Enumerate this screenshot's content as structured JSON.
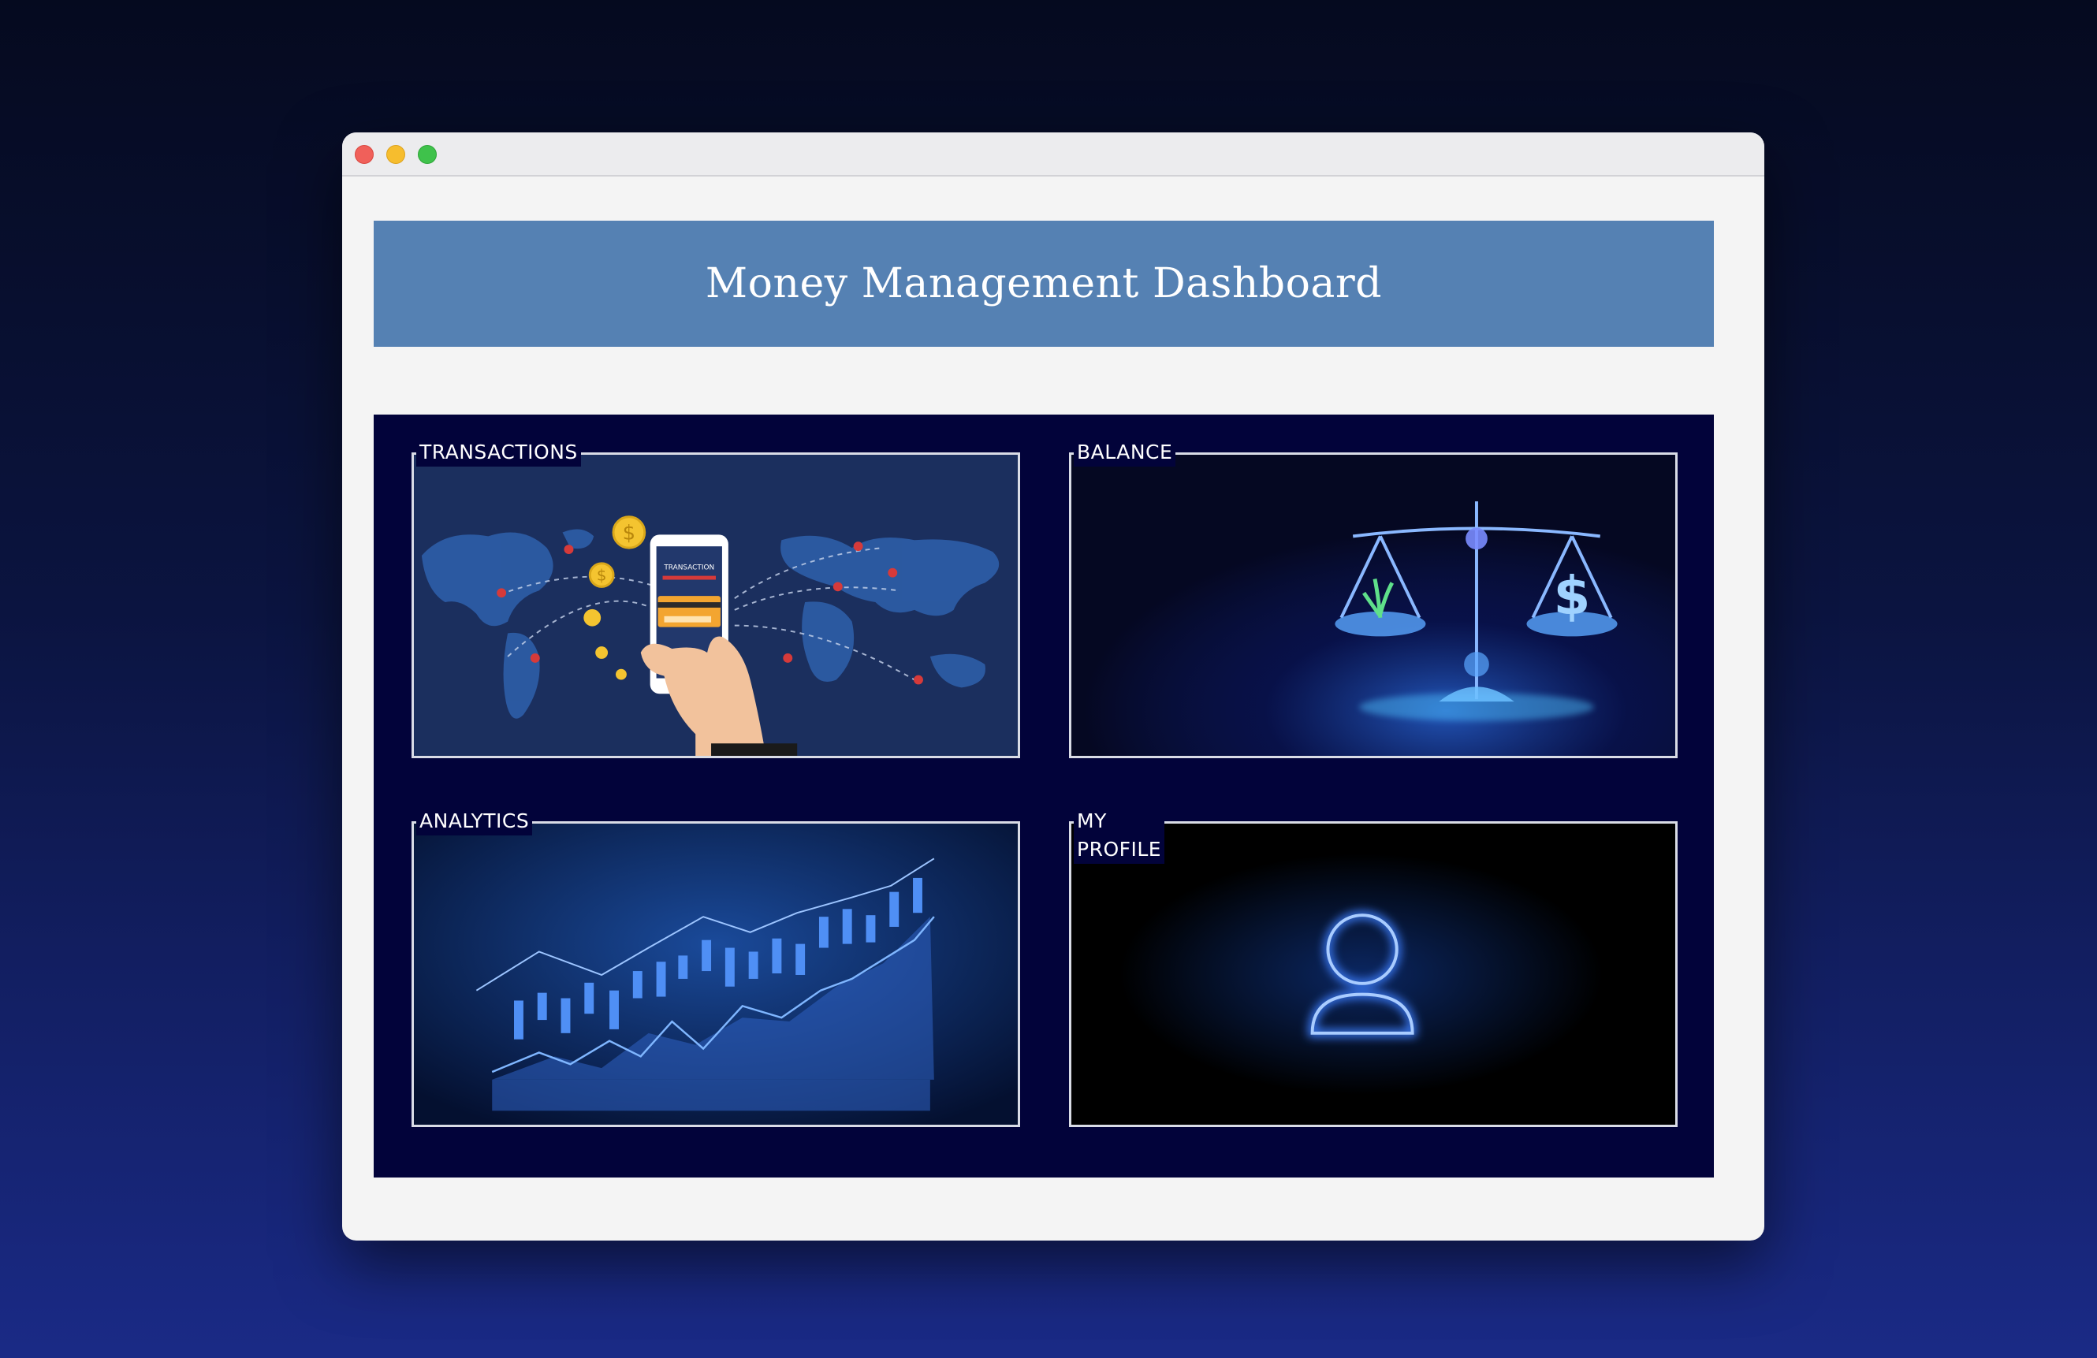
{
  "window": {
    "controls": [
      "close",
      "minimize",
      "maximize"
    ]
  },
  "header": {
    "title": "Money Management Dashboard"
  },
  "cards": [
    {
      "label": "TRANSACTIONS",
      "image": "world-map-phone-transaction",
      "phone_text": "TRANSACTION",
      "coin_symbol": "$"
    },
    {
      "label": "BALANCE",
      "image": "glowing-scale-balance",
      "coin_symbol": "$"
    },
    {
      "label": "ANALYTICS",
      "image": "candlestick-growth-chart"
    },
    {
      "label": "MY PROFILE",
      "image": "glowing-user-icon"
    }
  ],
  "colors": {
    "header_bg": "#5581b3",
    "grid_bg": "#02033a",
    "card_border": "#d9dce6"
  }
}
